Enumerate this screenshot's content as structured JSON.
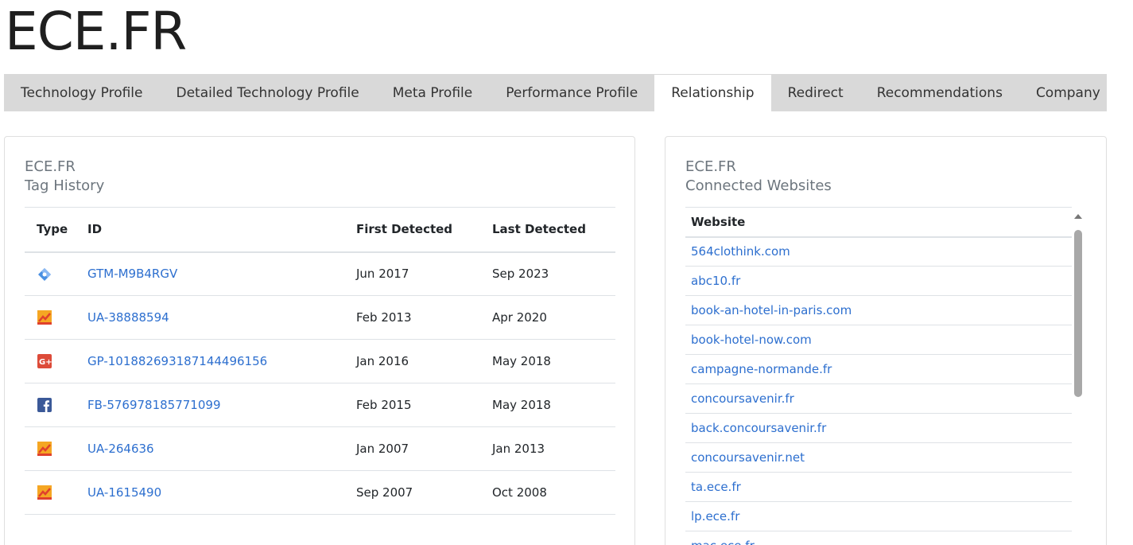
{
  "site": {
    "title": "ECE.FR"
  },
  "tabs": [
    {
      "label": "Technology Profile"
    },
    {
      "label": "Detailed Technology Profile"
    },
    {
      "label": "Meta Profile"
    },
    {
      "label": "Performance Profile"
    },
    {
      "label": "Relationship"
    },
    {
      "label": "Redirect"
    },
    {
      "label": "Recommendations"
    },
    {
      "label": "Company"
    }
  ],
  "active_tab": "Relationship",
  "tag_history": {
    "domain": "ECE.FR",
    "title": "Tag History",
    "headers": {
      "type": "Type",
      "id": "ID",
      "first": "First Detected",
      "last": "Last Detected"
    },
    "rows": [
      {
        "icon": "google-tag-manager-icon",
        "id": "GTM-M9B4RGV",
        "first": "Jun 2017",
        "last": "Sep 2023"
      },
      {
        "icon": "google-analytics-icon",
        "id": "UA-38888594",
        "first": "Feb 2013",
        "last": "Apr 2020"
      },
      {
        "icon": "google-plus-icon",
        "id": "GP-101882693187144496156",
        "first": "Jan 2016",
        "last": "May 2018"
      },
      {
        "icon": "facebook-icon",
        "id": "FB-576978185771099",
        "first": "Feb 2015",
        "last": "May 2018"
      },
      {
        "icon": "google-analytics-icon",
        "id": "UA-264636",
        "first": "Jan 2007",
        "last": "Jan 2013"
      },
      {
        "icon": "google-analytics-icon",
        "id": "UA-1615490",
        "first": "Sep 2007",
        "last": "Oct 2008"
      }
    ]
  },
  "connected": {
    "domain": "ECE.FR",
    "title": "Connected Websites",
    "header": "Website",
    "sites": [
      "564clothink.com",
      "abc10.fr",
      "book-an-hotel-in-paris.com",
      "book-hotel-now.com",
      "campagne-normande.fr",
      "concoursavenir.fr",
      "back.concoursavenir.fr",
      "concoursavenir.net",
      "ta.ece.fr",
      "lp.ece.fr",
      "mac.ece.fr"
    ]
  },
  "colors": {
    "link": "#2d6fcf",
    "tab_bar": "#d9d9d9",
    "muted": "#6c757d"
  }
}
